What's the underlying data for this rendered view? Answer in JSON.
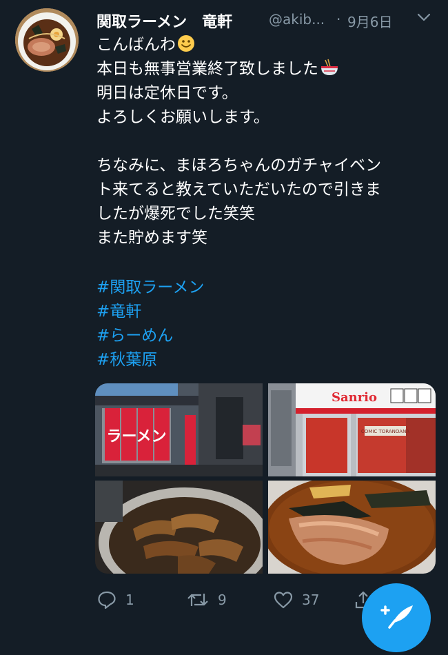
{
  "tweet": {
    "display_name": "関取ラーメン　竜軒",
    "handle": "@akib...",
    "separator": "·",
    "date": "9月6日",
    "lines": [
      "こんばんわ",
      "本日も無事営業終了致しました",
      "明日は定休日です。",
      "よろしくお願いします。",
      "",
      "ちなみに、まほろちゃんのガチャイベン",
      "ト来てると教えていただいたので引きま",
      "したが爆死でした笑笑",
      "また貯めます笑"
    ],
    "hashtags": [
      "#関取ラーメン",
      "#竜軒",
      "#らーめん",
      "#秋葉原"
    ]
  },
  "photos": {
    "ramen_sign_text": "ラーメン",
    "sanrio_sign_text": "Sanrio",
    "comic_sign_text": "COMIC TORANOANA"
  },
  "actions": {
    "replies": "1",
    "retweets": "9",
    "likes": "37"
  },
  "colors": {
    "background": "#141d26",
    "link": "#1da1f2",
    "muted": "#8899a6"
  },
  "icons": {
    "reply": "speech-bubble-icon",
    "retweet": "retweet-arrows-icon",
    "like": "heart-icon",
    "share": "share-icon",
    "menu": "chevron-down-icon",
    "compose": "compose-feather-icon"
  }
}
